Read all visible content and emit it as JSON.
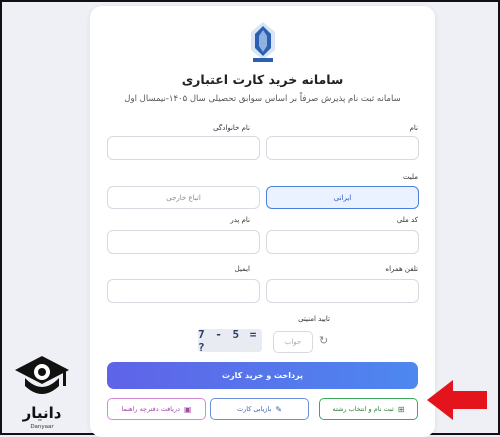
{
  "form": {
    "title": "سامانه خرید کارت اعتباری",
    "subtitle": "سامانه ثبت نام پذیرش صرفاً بر اساس سوابق تحصیلی سال ۱۴۰۵-نیمسال اول",
    "first_name_label": "نام",
    "last_name_label": "نام خانوادگی",
    "nationality_label": "ملیت",
    "nationality_options": [
      "ایرانی",
      "اتباع خارجی"
    ],
    "nationality_selected": "ایرانی",
    "national_code_label": "کد ملی",
    "father_name_label": "نام پدر",
    "mobile_label": "تلفن همراه",
    "email_label": "ایمیل",
    "captcha_label": "تایید امنیتی",
    "captcha_placeholder": "جواب",
    "captcha_text": "7 - 5 = ?",
    "submit_label": "پرداخت و خرید کارت"
  },
  "actions": {
    "register_label": "ثبت نام و انتخاب رشته",
    "recover_label": "بازیابی کارت",
    "guide_label": "دریافت دفترچه راهنما"
  },
  "brand": {
    "name": "دانیار",
    "latin": "Danyaar"
  },
  "colors": {
    "accent_blue": "#4a7fe0",
    "submit_start": "#5f63e8",
    "submit_end": "#4d88ef",
    "green": "#3aa95b",
    "pink": "#d58ad8",
    "arrow_red": "#e3141b"
  },
  "icons": {
    "register": "plus-square-icon",
    "recover": "pencil-icon",
    "guide": "image-icon",
    "refresh": "refresh-icon",
    "logo": "university-logo-icon"
  }
}
